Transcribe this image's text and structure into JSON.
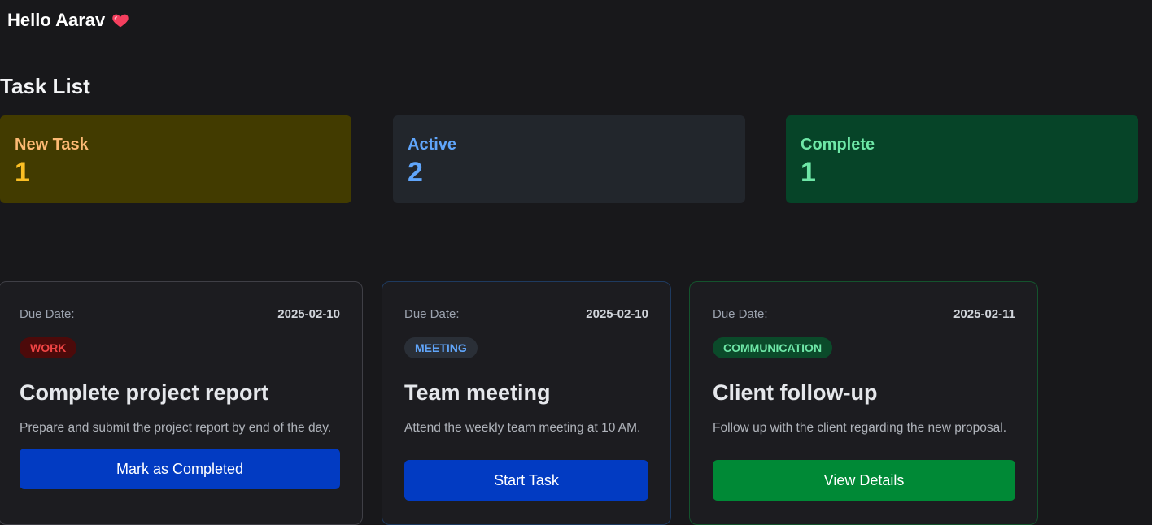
{
  "header": {
    "greeting": "Hello Aarav",
    "heart_icon": "heart-icon",
    "heart_color": "#f43f5e"
  },
  "task_list": {
    "title": "Task List",
    "stats": [
      {
        "label": "New Task",
        "count": "1",
        "color": "#fbbf24"
      },
      {
        "label": "Active",
        "count": "2",
        "color": "#60a5fa"
      },
      {
        "label": "Complete",
        "count": "1",
        "color": "#6ee7a7"
      }
    ]
  },
  "tasks": [
    {
      "due_label": "Due Date:",
      "due_date": "2025-02-10",
      "category": "WORK",
      "title": "Complete project report",
      "description": "Prepare and submit the project report by end of the day.",
      "action": "Mark as Completed"
    },
    {
      "due_label": "Due Date:",
      "due_date": "2025-02-10",
      "category": "MEETING",
      "title": "Team meeting",
      "description": "Attend the weekly team meeting at 10 AM.",
      "action": "Start Task"
    },
    {
      "due_label": "Due Date:",
      "due_date": "2025-02-11",
      "category": "COMMUNICATION",
      "title": "Client follow-up",
      "description": "Follow up with the client regarding the new proposal.",
      "action": "View Details"
    }
  ]
}
